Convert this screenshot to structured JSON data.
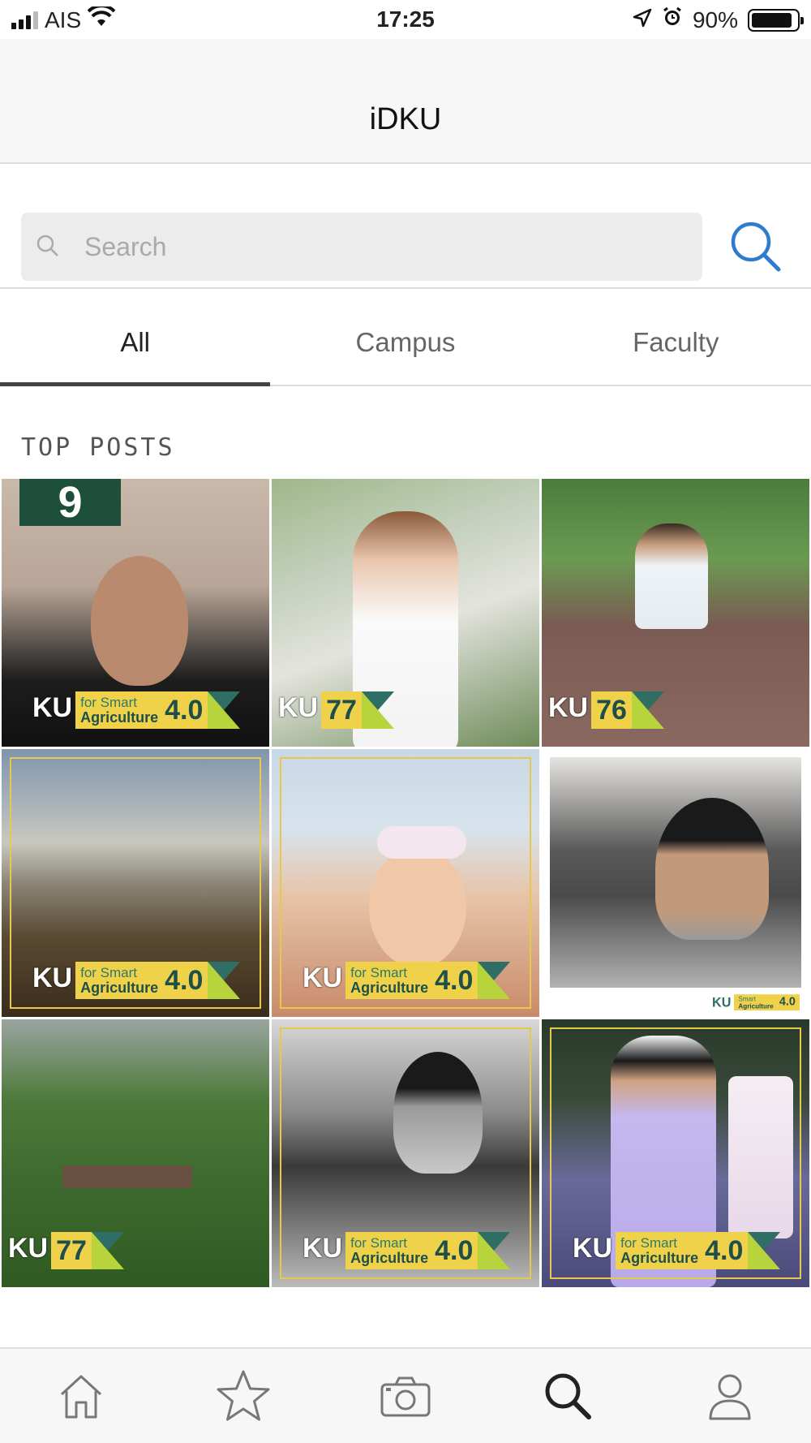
{
  "status_bar": {
    "carrier": "AIS",
    "time": "17:25",
    "battery_percent": "90%",
    "battery_level": 0.9,
    "icons": [
      "signal-icon",
      "wifi-icon",
      "location-icon",
      "alarm-icon",
      "battery-icon"
    ]
  },
  "header": {
    "title": "iDKU"
  },
  "search": {
    "placeholder": "Search",
    "value": ""
  },
  "tabs": [
    {
      "label": "All",
      "active": true
    },
    {
      "label": "Campus",
      "active": false
    },
    {
      "label": "Faculty",
      "active": false
    }
  ],
  "section": {
    "title": "TOP POSTS"
  },
  "posts": [
    {
      "badge_type": "agri",
      "ku": "KU",
      "line1": "for Smart",
      "line2": "Agriculture",
      "version": "4.0"
    },
    {
      "badge_type": "number",
      "ku": "KU",
      "number": "77"
    },
    {
      "badge_type": "number",
      "ku": "KU",
      "number": "76"
    },
    {
      "badge_type": "agri",
      "ku": "KU",
      "line1": "for Smart",
      "line2": "Agriculture",
      "version": "4.0"
    },
    {
      "badge_type": "agri",
      "ku": "KU",
      "line1": "for Smart",
      "line2": "Agriculture",
      "version": "4.0"
    },
    {
      "badge_type": "agri",
      "ku": "KU",
      "line1": "Smart",
      "line2": "Agriculture",
      "version": "4.0"
    },
    {
      "badge_type": "number",
      "ku": "KU",
      "number": "77"
    },
    {
      "badge_type": "agri",
      "ku": "KU",
      "line1": "for Smart",
      "line2": "Agriculture",
      "version": "4.0"
    },
    {
      "badge_type": "agri",
      "ku": "KU",
      "line1": "for Smart",
      "line2": "Agriculture",
      "version": "4.0"
    }
  ],
  "tabbar": [
    {
      "icon": "home-icon",
      "active": false
    },
    {
      "icon": "star-icon",
      "active": false
    },
    {
      "icon": "camera-icon",
      "active": false
    },
    {
      "icon": "search-icon",
      "active": true
    },
    {
      "icon": "profile-icon",
      "active": false
    }
  ],
  "colors": {
    "accent_blue": "#2f7bd0",
    "badge_yellow": "#f0d24a",
    "badge_green": "#2f6e64",
    "badge_lime": "#b8d43c"
  }
}
